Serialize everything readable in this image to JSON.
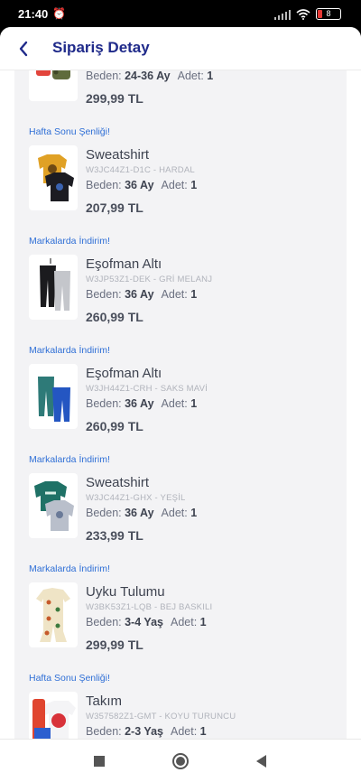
{
  "status": {
    "time": "21:40",
    "battery": "8"
  },
  "header": {
    "title": "Sipariş Detay"
  },
  "labels": {
    "size": "Beden:",
    "qty": "Adet:"
  },
  "items": [
    {
      "promo": "",
      "name": "",
      "code": "",
      "size": "24-36 Ay",
      "qty": "1",
      "price": "299,99 TL",
      "thumb": "set-camo"
    },
    {
      "promo": "Hafta Sonu Şenliği!",
      "name": "Sweatshirt",
      "code": "W3JC44Z1-D1C - HARDAL",
      "size": "36 Ay",
      "qty": "1",
      "price": "207,99 TL",
      "thumb": "sweatshirt-mustard-black"
    },
    {
      "promo": "Markalarda İndirim!",
      "name": "Eşofman Altı",
      "code": "W3JP53Z1-DEK - GRİ MELANJ",
      "size": "36 Ay",
      "qty": "1",
      "price": "260,99 TL",
      "thumb": "pants-black-grey"
    },
    {
      "promo": "Markalarda İndirim!",
      "name": "Eşofman Altı",
      "code": "W3JH44Z1-CRH - SAKS MAVİ",
      "size": "36 Ay",
      "qty": "1",
      "price": "260,99 TL",
      "thumb": "pants-teal-blue"
    },
    {
      "promo": "Markalarda İndirim!",
      "name": "Sweatshirt",
      "code": "W3JC44Z1-GHX - YEŞİL",
      "size": "36 Ay",
      "qty": "1",
      "price": "233,99 TL",
      "thumb": "sweatshirt-green-grey"
    },
    {
      "promo": "Markalarda İndirim!",
      "name": "Uyku Tulumu",
      "code": "W3BK53Z1-LQB - BEJ BASKILI",
      "size": "3-4 Yaş",
      "qty": "1",
      "price": "299,99 TL",
      "thumb": "sleepsuit-beige"
    },
    {
      "promo": "Hafta Sonu Şenliği!",
      "name": "Takım",
      "code": "W357582Z1-GMT - KOYU TURUNCU",
      "size": "2-3 Yaş",
      "qty": "1",
      "price": "",
      "thumb": "set-spiderman"
    }
  ]
}
